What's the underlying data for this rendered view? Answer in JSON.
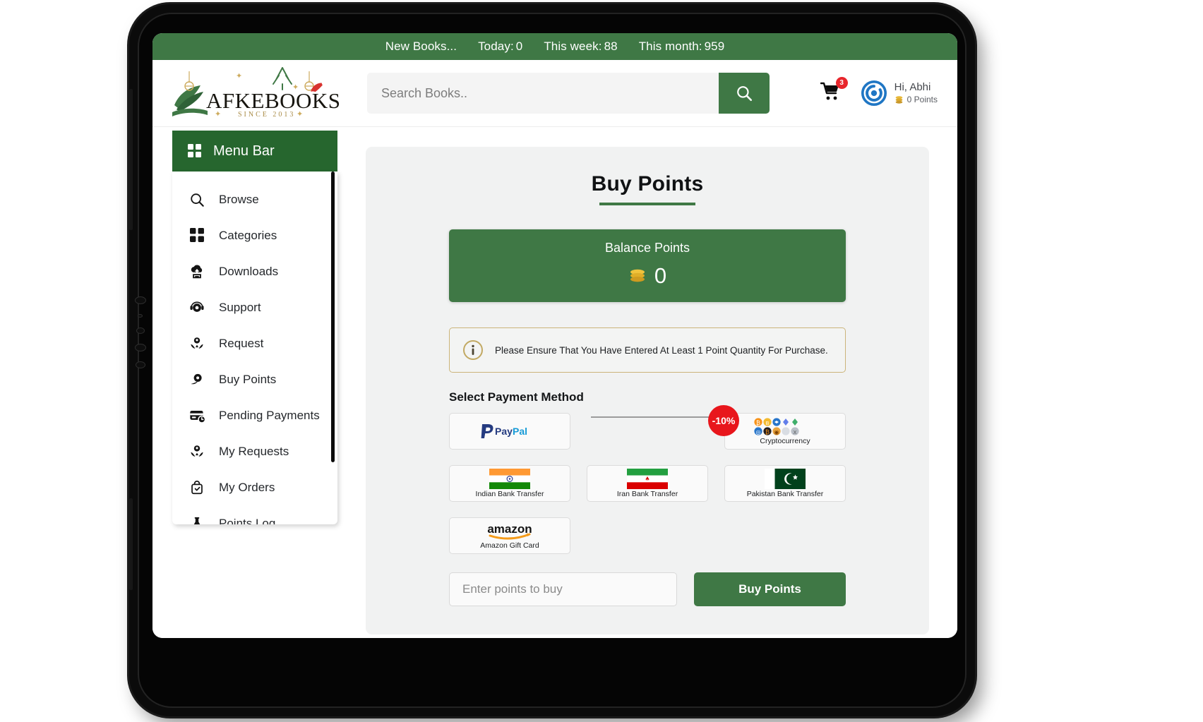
{
  "topbar": {
    "new_books_label": "New Books...",
    "stats": [
      {
        "label": "Today:",
        "value": "0"
      },
      {
        "label": "This week:",
        "value": "88"
      },
      {
        "label": "This month:",
        "value": "959"
      }
    ]
  },
  "brand": {
    "name": "AFKEBOOKS",
    "since": "SINCE 2013"
  },
  "search": {
    "placeholder": "Search Books..",
    "value": ""
  },
  "header": {
    "cart_badge": "3",
    "greeting": "Hi, Abhi",
    "points": "0 Points"
  },
  "sidebar": {
    "header_label": "Menu Bar",
    "items": [
      {
        "label": "Browse",
        "icon": "search-icon"
      },
      {
        "label": "Categories",
        "icon": "grid-icon"
      },
      {
        "label": "Downloads",
        "icon": "download-cloud-icon"
      },
      {
        "label": "Support",
        "icon": "headset-icon"
      },
      {
        "label": "Request",
        "icon": "hands-user-icon"
      },
      {
        "label": "Buy Points",
        "icon": "coin-hand-icon"
      },
      {
        "label": "Pending Payments",
        "icon": "card-clock-icon"
      },
      {
        "label": "My Requests",
        "icon": "hands-user-icon"
      },
      {
        "label": "My Orders",
        "icon": "bag-check-icon"
      },
      {
        "label": "Points Log",
        "icon": "flask-icon"
      }
    ]
  },
  "main": {
    "title": "Buy Points",
    "balance": {
      "label": "Balance Points",
      "value": "0"
    },
    "notice": "Please Ensure That You Have Entered At Least 1 Point Quantity For Purchase.",
    "payment_section_title": "Select Payment Method",
    "payment_methods": [
      {
        "label": "PayPal",
        "kind": "paypal",
        "badge": ""
      },
      {
        "label": "",
        "kind": "broken",
        "badge": ""
      },
      {
        "label": "Cryptocurrency",
        "kind": "crypto",
        "badge": "-10%"
      },
      {
        "label": "Indian Bank Transfer",
        "kind": "flag-in",
        "badge": ""
      },
      {
        "label": "Iran Bank Transfer",
        "kind": "flag-ir",
        "badge": ""
      },
      {
        "label": "Pakistan Bank Transfer",
        "kind": "flag-pk",
        "badge": ""
      },
      {
        "label": "Amazon Gift Card",
        "kind": "amazon",
        "badge": ""
      }
    ],
    "points_input": {
      "placeholder": "Enter points to buy",
      "value": ""
    },
    "buy_button": "Buy Points"
  },
  "colors": {
    "brand_green": "#3f7845",
    "menu_green": "#26662e",
    "badge_red": "#e8161c",
    "notice_border": "#cbb47a"
  }
}
